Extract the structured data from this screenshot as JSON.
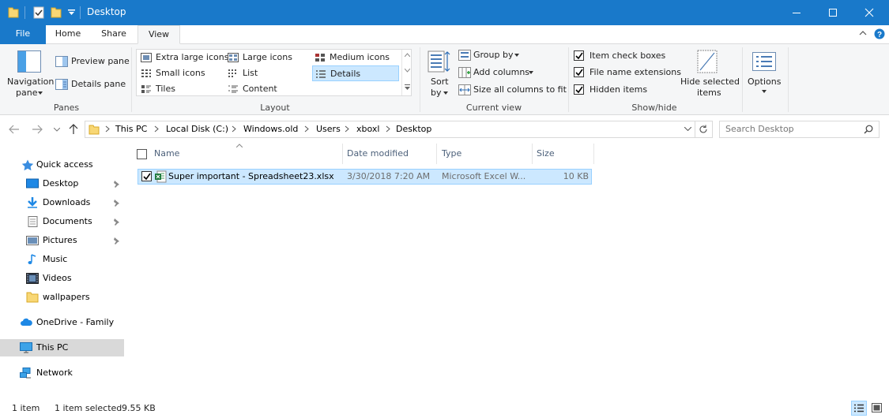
{
  "window": {
    "title": "Desktop"
  },
  "tabs": {
    "file": "File",
    "home": "Home",
    "share": "Share",
    "view": "View"
  },
  "ribbon": {
    "panes": {
      "navigation_pane_line1": "Navigation",
      "navigation_pane_line2": "pane",
      "preview_pane": "Preview pane",
      "details_pane": "Details pane",
      "group_label": "Panes"
    },
    "layout": {
      "items": [
        {
          "label": "Extra large icons"
        },
        {
          "label": "Large icons"
        },
        {
          "label": "Medium icons"
        },
        {
          "label": "Small icons"
        },
        {
          "label": "List"
        },
        {
          "label": "Details"
        },
        {
          "label": "Tiles"
        },
        {
          "label": "Content"
        }
      ],
      "selected": "Details",
      "group_label": "Layout"
    },
    "current_view": {
      "sort_line1": "Sort",
      "sort_line2": "by",
      "group_by": "Group by",
      "add_columns": "Add columns",
      "size_all_columns": "Size all columns to fit",
      "group_label": "Current view"
    },
    "show_hide": {
      "item_check_boxes": "Item check boxes",
      "file_name_extensions": "File name extensions",
      "hidden_items": "Hidden items",
      "item_check_boxes_checked": true,
      "file_name_extensions_checked": true,
      "hidden_items_checked": true,
      "hide_selected_line1": "Hide selected",
      "hide_selected_line2": "items",
      "group_label": "Show/hide"
    },
    "options": {
      "label": "Options"
    }
  },
  "address": {
    "breadcrumbs": [
      "This PC",
      "Local Disk (C:)",
      "Windows.old",
      "Users",
      "xboxl",
      "Desktop"
    ],
    "search_placeholder": "Search Desktop"
  },
  "nav": {
    "quick_access": "Quick access",
    "items": [
      {
        "label": "Desktop",
        "pinned": true
      },
      {
        "label": "Downloads",
        "pinned": true
      },
      {
        "label": "Documents",
        "pinned": true
      },
      {
        "label": "Pictures",
        "pinned": true
      },
      {
        "label": "Music",
        "pinned": false
      },
      {
        "label": "Videos",
        "pinned": false
      },
      {
        "label": "wallpapers",
        "pinned": false
      }
    ],
    "onedrive": "OneDrive - Family",
    "this_pc": "This PC",
    "network": "Network"
  },
  "columns": {
    "name": "Name",
    "date_modified": "Date modified",
    "type": "Type",
    "size": "Size"
  },
  "files": [
    {
      "name": "Super important - Spreadsheet23.xlsx",
      "date_modified": "3/30/2018 7:20 AM",
      "type": "Microsoft Excel W...",
      "size": "10 KB",
      "selected": true
    }
  ],
  "status": {
    "item_count": "1 item",
    "selected": "1 item selected",
    "selected_size": "9.55 KB"
  },
  "colors": {
    "accent": "#1979ca",
    "selection": "#cce8ff",
    "selection_border": "#99d1ff"
  }
}
